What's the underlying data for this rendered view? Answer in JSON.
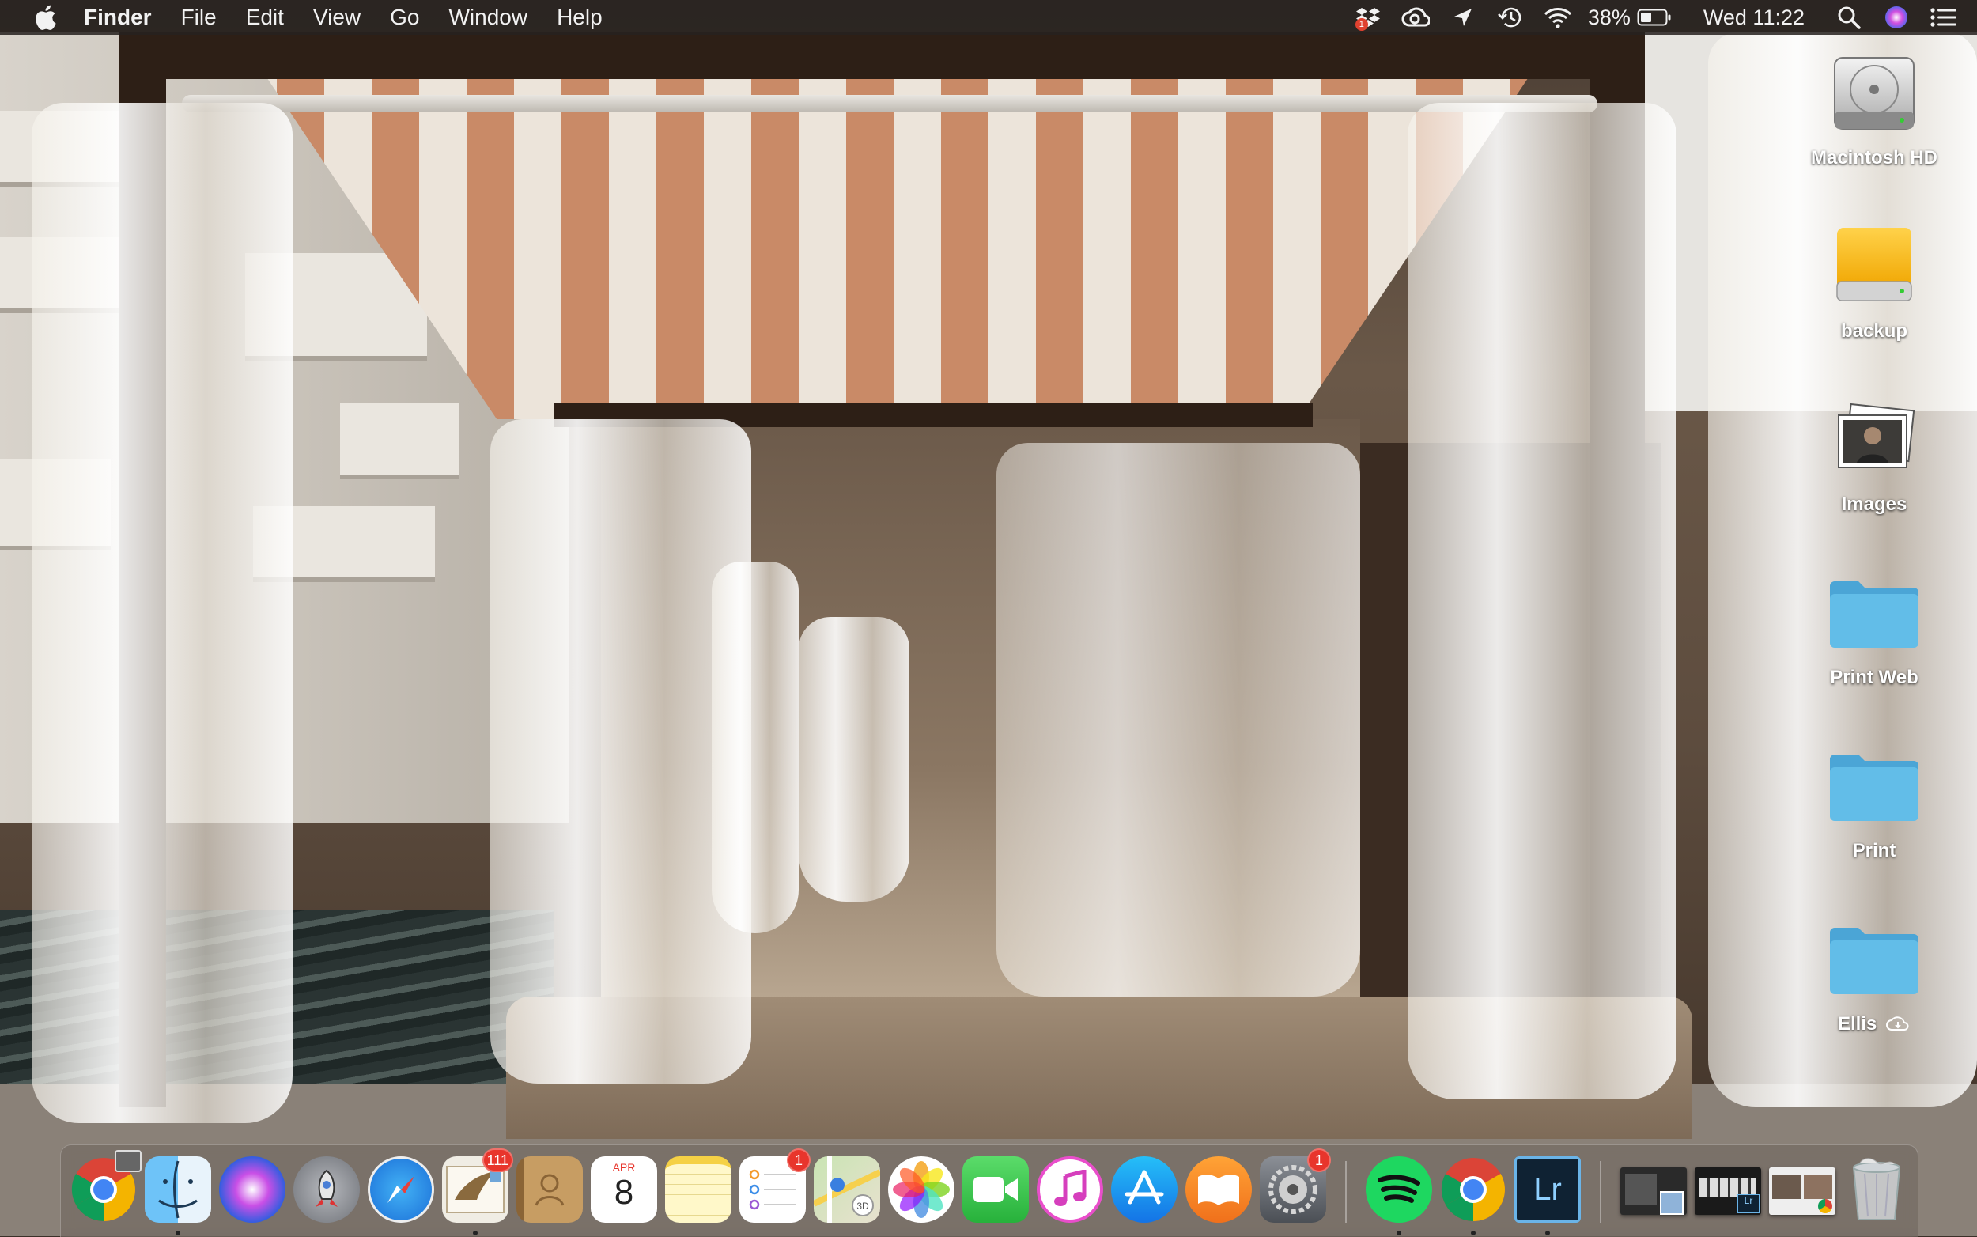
{
  "menubar": {
    "app_name": "Finder",
    "menus": [
      "File",
      "Edit",
      "View",
      "Go",
      "Window",
      "Help"
    ],
    "status": {
      "dropbox_badge": "1",
      "battery_percent": "38%",
      "clock": "Wed 11:22"
    },
    "icons": [
      "apple-logo-icon",
      "dropbox-icon",
      "creative-cloud-icon",
      "location-icon",
      "time-machine-icon",
      "wifi-icon",
      "battery-icon",
      "spotlight-icon",
      "siri-icon",
      "notification-center-icon"
    ]
  },
  "desktop": {
    "items": [
      {
        "label": "Macintosh HD",
        "icon": "hard-drive-icon"
      },
      {
        "label": "backup",
        "icon": "external-drive-icon"
      },
      {
        "label": "Images",
        "icon": "image-stack-icon"
      },
      {
        "label": "Print Web",
        "icon": "folder-icon"
      },
      {
        "label": "Print",
        "icon": "folder-icon"
      },
      {
        "label": "Ellis",
        "icon": "folder-icon",
        "suffix_icon": "icloud-download-icon"
      }
    ]
  },
  "dock": {
    "apps": [
      {
        "name": "Chrome Canary",
        "icon": "chrome-icon",
        "running": false
      },
      {
        "name": "Finder",
        "icon": "finder-icon",
        "running": true
      },
      {
        "name": "Siri",
        "icon": "siri-icon",
        "running": false
      },
      {
        "name": "Launchpad",
        "icon": "launchpad-icon",
        "running": false
      },
      {
        "name": "Safari",
        "icon": "safari-icon",
        "running": false
      },
      {
        "name": "Mail",
        "icon": "mail-icon",
        "running": true,
        "badge": "111"
      },
      {
        "name": "Contacts",
        "icon": "contacts-icon",
        "running": false
      },
      {
        "name": "Calendar",
        "icon": "calendar-icon",
        "running": false,
        "month": "APR",
        "day": "8"
      },
      {
        "name": "Notes",
        "icon": "notes-icon",
        "running": false
      },
      {
        "name": "Reminders",
        "icon": "reminders-icon",
        "running": false,
        "badge": "1"
      },
      {
        "name": "Maps",
        "icon": "maps-icon",
        "running": false
      },
      {
        "name": "Photos",
        "icon": "photos-icon",
        "running": false
      },
      {
        "name": "FaceTime",
        "icon": "facetime-icon",
        "running": false
      },
      {
        "name": "iTunes",
        "icon": "itunes-icon",
        "running": false
      },
      {
        "name": "App Store",
        "icon": "app-store-icon",
        "running": false
      },
      {
        "name": "iBooks",
        "icon": "ibooks-icon",
        "running": false
      },
      {
        "name": "System Preferences",
        "icon": "system-preferences-icon",
        "running": false,
        "badge": "1"
      },
      {
        "name": "Spotify",
        "icon": "spotify-icon",
        "running": true
      },
      {
        "name": "Google Chrome",
        "icon": "chrome-icon",
        "running": true
      },
      {
        "name": "Lightroom",
        "icon": "lightroom-icon",
        "running": true,
        "text": "Lr"
      }
    ],
    "trash": {
      "name": "Trash",
      "icon": "trash-icon"
    }
  }
}
